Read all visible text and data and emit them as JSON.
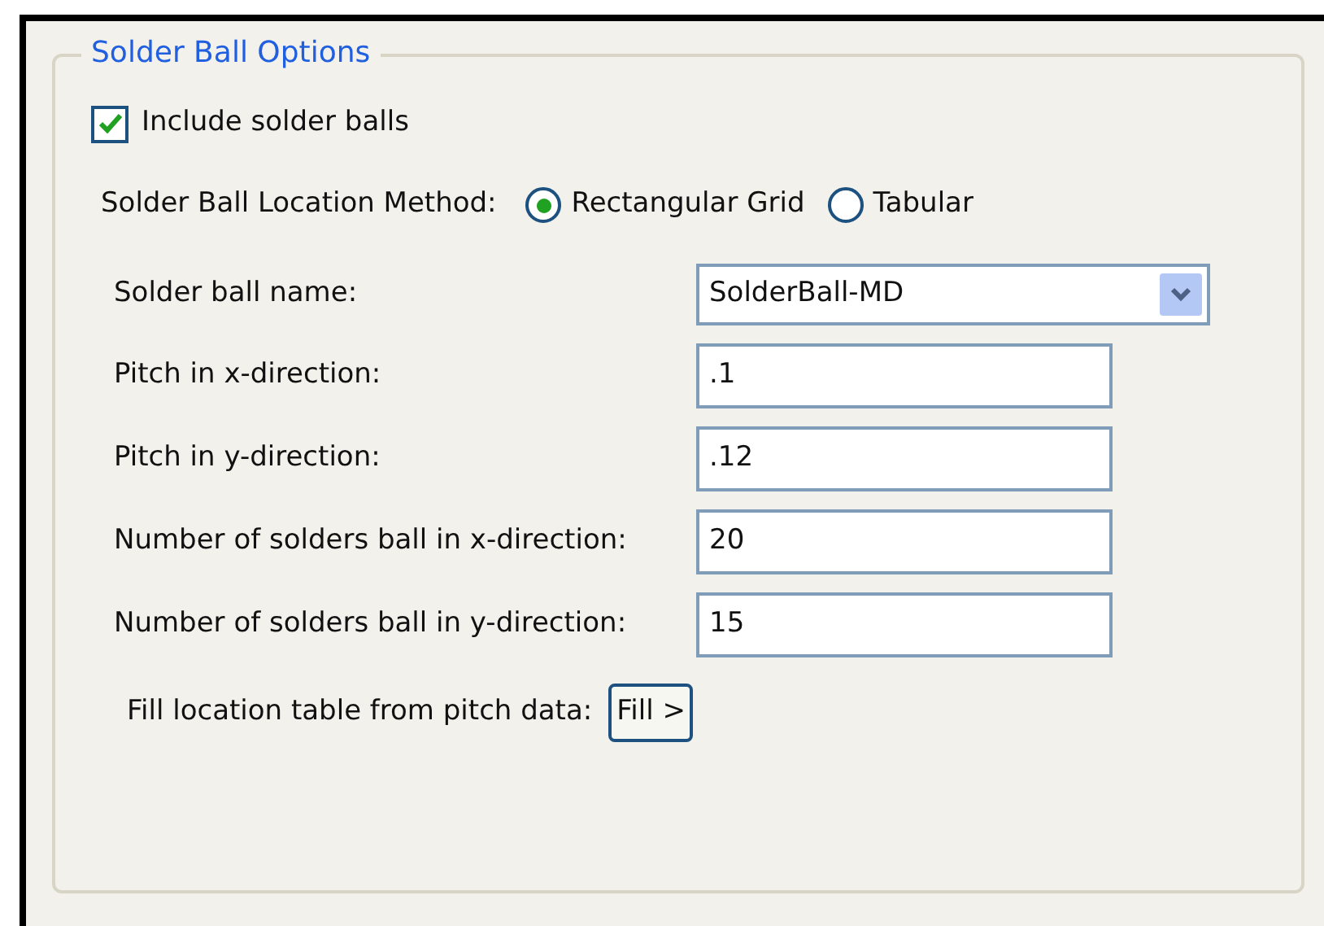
{
  "group": {
    "title": "Solder Ball Options"
  },
  "include": {
    "label": "Include solder balls",
    "checked": true
  },
  "method": {
    "label": "Solder Ball Location Method:",
    "options": [
      {
        "label": "Rectangular Grid",
        "selected": true
      },
      {
        "label": "Tabular",
        "selected": false
      }
    ]
  },
  "fields": [
    {
      "kind": "dropdown",
      "label": "Solder ball name:",
      "value": "SolderBall-MD"
    },
    {
      "kind": "text",
      "label": "Pitch in x-direction:",
      "value": ".1"
    },
    {
      "kind": "text",
      "label": "Pitch in y-direction:",
      "value": ".12"
    },
    {
      "kind": "text",
      "label": "Number of solders ball in x-direction:",
      "value": "20"
    },
    {
      "kind": "text",
      "label": "Number of solders ball in y-direction:",
      "value": "15"
    }
  ],
  "fill": {
    "label": "Fill location table from pitch data:",
    "button": "Fill >"
  }
}
